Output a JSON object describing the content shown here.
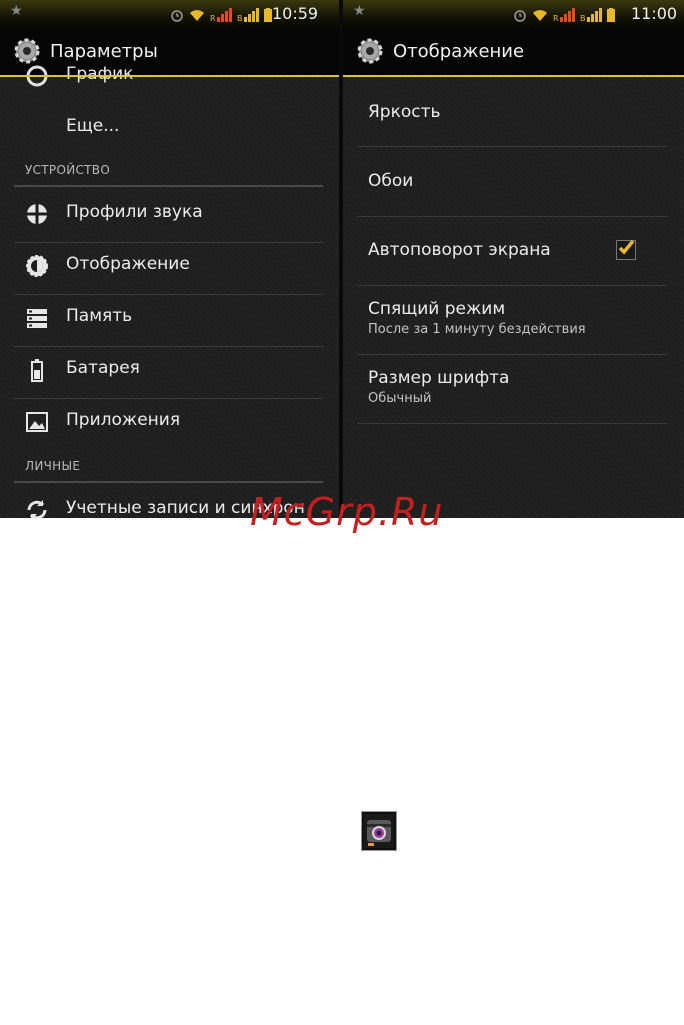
{
  "left": {
    "status": {
      "time": "10:59"
    },
    "title": "Параметры",
    "items": [
      {
        "label": "График"
      },
      {
        "label": "Еще..."
      },
      {
        "label": "Профили звука"
      },
      {
        "label": "Отображение"
      },
      {
        "label": "Память"
      },
      {
        "label": "Батарея"
      },
      {
        "label": "Приложения"
      },
      {
        "label": "Учетные записи и синхрон"
      }
    ],
    "sections": [
      "УСТРОЙСТВО",
      "ЛИЧНЫЕ"
    ]
  },
  "right": {
    "status": {
      "time": "11:00"
    },
    "title": "Отображение",
    "items": [
      {
        "title": "Яркость"
      },
      {
        "title": "Обои"
      },
      {
        "title": "Автоповорот экрана",
        "checked": true
      },
      {
        "title": "Спящий режим",
        "subtitle": "После за 1 минуту бездействия"
      },
      {
        "title": "Размер шрифта",
        "subtitle": "Обычный"
      }
    ]
  },
  "watermark": "McGrp.Ru",
  "colors": {
    "accent": "#d9c43a",
    "check": "#e8b82a",
    "watermark": "#c42020"
  }
}
